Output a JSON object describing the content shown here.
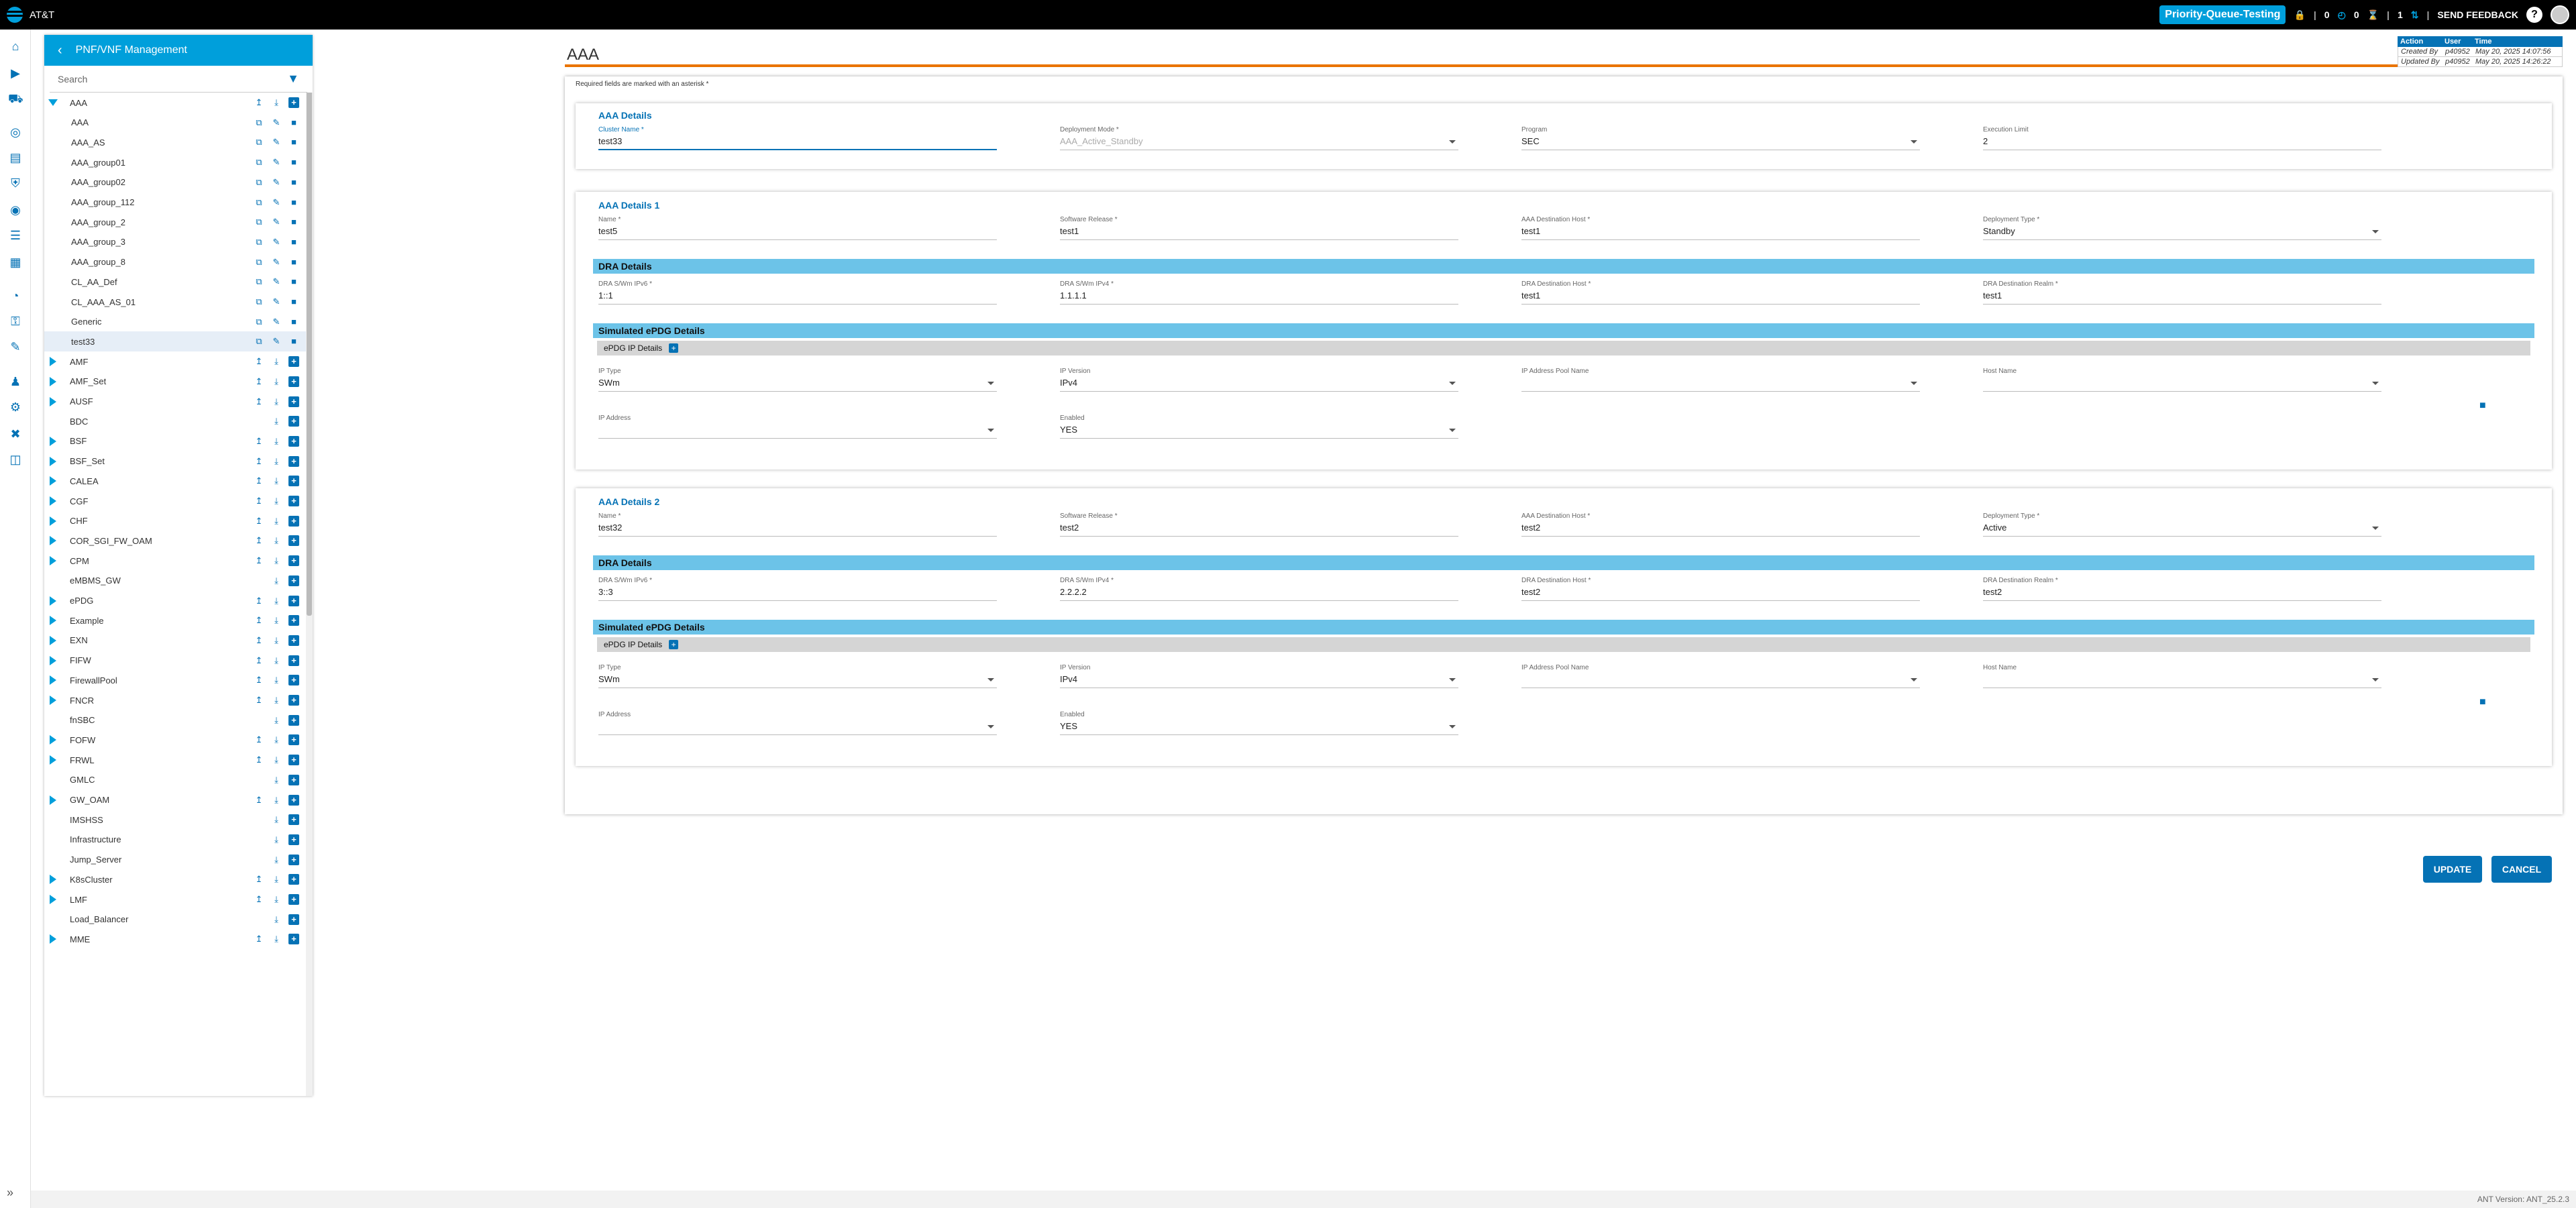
{
  "topbar": {
    "brand": "AT&T",
    "queue_label": "Priority-Queue-Testing",
    "count_a": "0",
    "count_b": "0",
    "count_c": "1",
    "send_feedback": "SEND FEEDBACK",
    "help": "?"
  },
  "tree": {
    "title": "PNF/VNF Management",
    "search_placeholder": "Search",
    "aaa_parent": "AAA",
    "aaa_children": [
      "AAA",
      "AAA_AS",
      "AAA_group01",
      "AAA_group02",
      "AAA_group_112",
      "AAA_group_2",
      "AAA_group_3",
      "AAA_group_8",
      "CL_AA_Def",
      "CL_AAA_AS_01",
      "Generic",
      "test33"
    ],
    "nodes": [
      {
        "label": "AMF",
        "expandable": true
      },
      {
        "label": "AMF_Set",
        "expandable": true
      },
      {
        "label": "AUSF",
        "expandable": true
      },
      {
        "label": "BDC",
        "expandable": false
      },
      {
        "label": "BSF",
        "expandable": true
      },
      {
        "label": "BSF_Set",
        "expandable": true
      },
      {
        "label": "CALEA",
        "expandable": true
      },
      {
        "label": "CGF",
        "expandable": true
      },
      {
        "label": "CHF",
        "expandable": true
      },
      {
        "label": "COR_SGI_FW_OAM",
        "expandable": true
      },
      {
        "label": "CPM",
        "expandable": true
      },
      {
        "label": "eMBMS_GW",
        "expandable": false
      },
      {
        "label": "ePDG",
        "expandable": true
      },
      {
        "label": "Example",
        "expandable": true
      },
      {
        "label": "EXN",
        "expandable": true
      },
      {
        "label": "FIFW",
        "expandable": true
      },
      {
        "label": "FirewallPool",
        "expandable": true
      },
      {
        "label": "FNCR",
        "expandable": true
      },
      {
        "label": "fnSBC",
        "expandable": false
      },
      {
        "label": "FOFW",
        "expandable": true
      },
      {
        "label": "FRWL",
        "expandable": true
      },
      {
        "label": "GMLC",
        "expandable": false
      },
      {
        "label": "GW_OAM",
        "expandable": true
      },
      {
        "label": "IMSHSS",
        "expandable": false
      },
      {
        "label": "Infrastructure",
        "expandable": false
      },
      {
        "label": "Jump_Server",
        "expandable": false
      },
      {
        "label": "K8sCluster",
        "expandable": true
      },
      {
        "label": "LMF",
        "expandable": true
      },
      {
        "label": "Load_Balancer",
        "expandable": false
      },
      {
        "label": "MME",
        "expandable": true
      }
    ]
  },
  "audit": {
    "headers": [
      "Action",
      "User",
      "Time"
    ],
    "rows": [
      [
        "Created By",
        "p40952",
        "May 20, 2025 14:07:56"
      ],
      [
        "Updated By",
        "p40952",
        "May 20, 2025 14:26:22"
      ]
    ]
  },
  "form": {
    "title": "AAA",
    "required_note": "Required fields are marked with an asterisk *",
    "details": {
      "title": "AAA Details",
      "cluster_name": {
        "label": "Cluster Name *",
        "value": "test33"
      },
      "deployment_mode": {
        "label": "Deployment Mode *",
        "value": "AAA_Active_Standby"
      },
      "program": {
        "label": "Program",
        "value": "SEC"
      },
      "execution_limit": {
        "label": "Execution Limit",
        "value": "2"
      }
    },
    "sections": [
      {
        "title": "AAA Details 1",
        "name": {
          "label": "Name *",
          "value": "test5"
        },
        "software_release": {
          "label": "Software Release *",
          "value": "test1"
        },
        "dest_host": {
          "label": "AAA Destination Host *",
          "value": "test1"
        },
        "deployment_type": {
          "label": "Deployment Type *",
          "value": "Standby"
        },
        "dra_title": "DRA Details",
        "dra_ipv6": {
          "label": "DRA S/Wm IPv6 *",
          "value": "1::1"
        },
        "dra_ipv4": {
          "label": "DRA S/Wm IPv4 *",
          "value": "1.1.1.1"
        },
        "dra_host": {
          "label": "DRA Destination Host *",
          "value": "test1"
        },
        "dra_realm": {
          "label": "DRA Destination Realm *",
          "value": "test1"
        },
        "sim_title": "Simulated ePDG Details",
        "epdg_title": "ePDG IP Details",
        "ip_type": {
          "label": "IP Type",
          "value": "SWm"
        },
        "ip_version": {
          "label": "IP Version",
          "value": "IPv4"
        },
        "pool_name": {
          "label": "IP Address Pool Name",
          "value": ""
        },
        "host_name": {
          "label": "Host Name",
          "value": ""
        },
        "ip_address": {
          "label": "IP Address",
          "value": ""
        },
        "enabled": {
          "label": "Enabled",
          "value": "YES"
        }
      },
      {
        "title": "AAA Details 2",
        "name": {
          "label": "Name *",
          "value": "test32"
        },
        "software_release": {
          "label": "Software Release *",
          "value": "test2"
        },
        "dest_host": {
          "label": "AAA Destination Host *",
          "value": "test2"
        },
        "deployment_type": {
          "label": "Deployment Type *",
          "value": "Active"
        },
        "dra_title": "DRA Details",
        "dra_ipv6": {
          "label": "DRA S/Wm IPv6 *",
          "value": "3::3"
        },
        "dra_ipv4": {
          "label": "DRA S/Wm IPv4 *",
          "value": "2.2.2.2"
        },
        "dra_host": {
          "label": "DRA Destination Host *",
          "value": "test2"
        },
        "dra_realm": {
          "label": "DRA Destination Realm *",
          "value": "test2"
        },
        "sim_title": "Simulated ePDG Details",
        "epdg_title": "ePDG IP Details",
        "ip_type": {
          "label": "IP Type",
          "value": "SWm"
        },
        "ip_version": {
          "label": "IP Version",
          "value": "IPv4"
        },
        "pool_name": {
          "label": "IP Address Pool Name",
          "value": ""
        },
        "host_name": {
          "label": "Host Name",
          "value": ""
        },
        "ip_address": {
          "label": "IP Address",
          "value": ""
        },
        "enabled": {
          "label": "Enabled",
          "value": "YES"
        }
      }
    ],
    "update_label": "UPDATE",
    "cancel_label": "CANCEL"
  },
  "footer": {
    "version": "ANT Version: ANT_25.2.3"
  },
  "colors": {
    "accent": "#009fdb",
    "primary": "#0572b5",
    "orange": "#ea7400"
  }
}
